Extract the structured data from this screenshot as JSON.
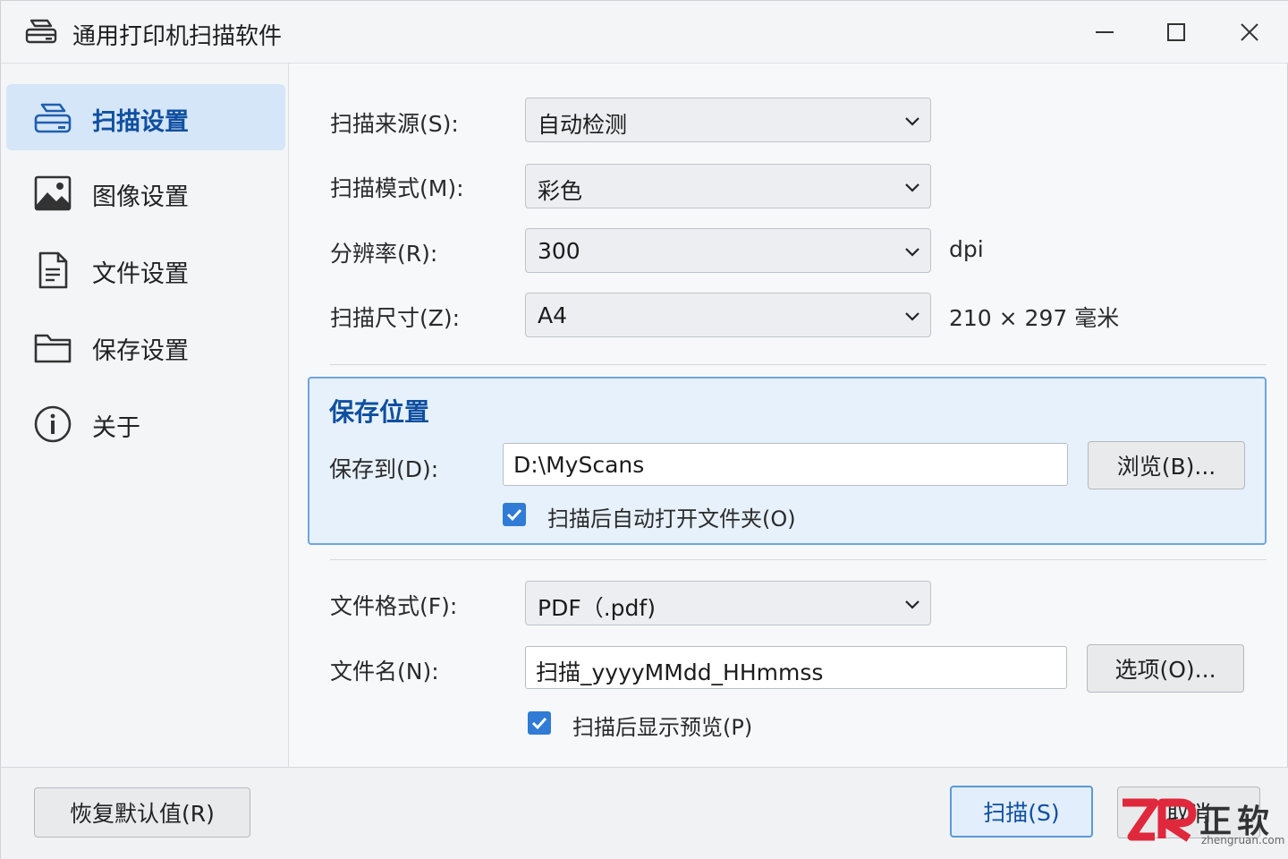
{
  "window": {
    "title": "通用打印机扫描软件",
    "icon": "scanner-icon",
    "controls": [
      "minimize-icon",
      "maximize-icon",
      "close-icon"
    ]
  },
  "sidebar": {
    "items": [
      {
        "label": "扫描设置",
        "icon": "scanner-icon",
        "active": true
      },
      {
        "label": "图像设置",
        "icon": "image-icon",
        "active": false
      },
      {
        "label": "文件设置",
        "icon": "document-icon",
        "active": false
      },
      {
        "label": "保存设置",
        "icon": "folder-icon",
        "active": false
      },
      {
        "label": "关于",
        "icon": "info-icon",
        "active": false
      }
    ]
  },
  "scan": {
    "source_label": "扫描来源(S):",
    "source_value": "自动检测",
    "mode_label": "扫描模式(M):",
    "mode_value": "彩色",
    "resolution_label": "分辨率(R):",
    "resolution_value": "300",
    "resolution_unit": "dpi",
    "size_label": "扫描尺寸(Z):",
    "size_value": "A4",
    "size_dimensions": "210 × 297 毫米"
  },
  "save_location": {
    "title": "保存位置",
    "path_label": "保存到(D):",
    "path_value": "D:\\MyScans",
    "browse_label": "浏览(B)...",
    "open_folder_label": "扫描后自动打开文件夹(O)",
    "open_folder_checked": true
  },
  "file": {
    "format_label": "文件格式(F):",
    "format_value": "PDF（.pdf)",
    "name_label": "文件名(N):",
    "name_value": "扫描_yyyyMMdd_HHmmss",
    "options_label": "选项(O)...",
    "preview_label": "扫描后显示预览(P)",
    "preview_checked": true
  },
  "footer": {
    "reset_label": "恢复默认值(R)",
    "scan_label": "扫描(S)",
    "cancel_label": "取消"
  },
  "watermark": {
    "brand": "正软",
    "url": "zhengruan.com"
  },
  "colors": {
    "accent": "#0f4fa0",
    "active_nav_bg": "#d5e6f8",
    "group_bg": "#e6f1fb",
    "group_border": "#6ea6dc",
    "checkbox": "#2f7bd6",
    "watermark_red": "#e0283c"
  }
}
